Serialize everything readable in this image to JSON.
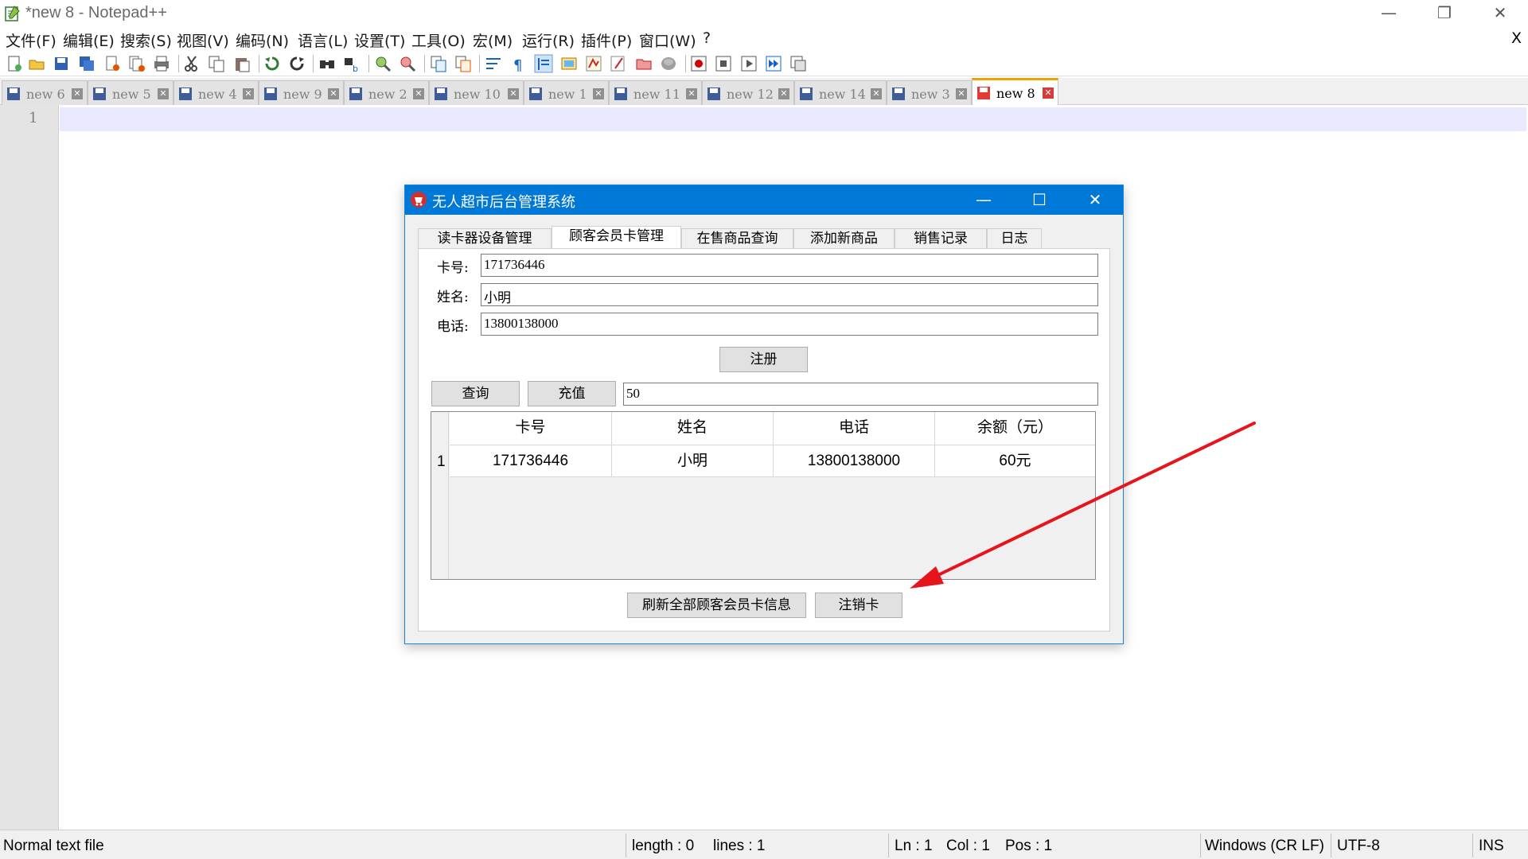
{
  "window": {
    "title": "*new 8 - Notepad++",
    "minimize": "—",
    "restore": "❐",
    "close": "✕"
  },
  "menu": {
    "items": [
      "文件(F)",
      "编辑(E)",
      "搜索(S)",
      "视图(V)",
      "编码(N)",
      "语言(L)",
      "设置(T)",
      "工具(O)",
      "宏(M)",
      "运行(R)",
      "插件(P)",
      "窗口(W)",
      "?"
    ],
    "close_doc": "X"
  },
  "toolbar": {
    "icons": [
      "new-file-icon",
      "open-file-icon",
      "save-icon",
      "save-all-icon",
      "close-icon",
      "close-all-icon",
      "print-icon",
      "cut-icon",
      "copy-icon",
      "paste-icon",
      "undo-icon",
      "redo-icon",
      "find-icon",
      "replace-icon",
      "zoom-in-icon",
      "zoom-out-icon",
      "sync-vertical-icon",
      "sync-horizontal-icon",
      "word-wrap-icon",
      "show-all-chars-icon",
      "indent-guide-icon",
      "doc-map-icon",
      "function-list-icon",
      "folder-as-workspace-icon",
      "monitoring-icon",
      "record-macro-icon",
      "stop-macro-icon",
      "play-macro-icon",
      "run-macro-multiple-icon",
      "save-macro-icon"
    ]
  },
  "tabs": [
    {
      "label": "new 6",
      "active": false
    },
    {
      "label": "new 5",
      "active": false
    },
    {
      "label": "new 4",
      "active": false
    },
    {
      "label": "new 9",
      "active": false
    },
    {
      "label": "new 2",
      "active": false
    },
    {
      "label": "new 10",
      "active": false
    },
    {
      "label": "new 1",
      "active": false
    },
    {
      "label": "new 11",
      "active": false
    },
    {
      "label": "new 12",
      "active": false
    },
    {
      "label": "new 14",
      "active": false
    },
    {
      "label": "new 3",
      "active": false
    },
    {
      "label": "new 8",
      "active": true
    }
  ],
  "editor": {
    "line_number": "1"
  },
  "statusbar": {
    "file_type": "Normal text file",
    "length": "length : 0",
    "lines": "lines : 1",
    "ln": "Ln : 1",
    "col": "Col : 1",
    "pos": "Pos : 1",
    "eol": "Windows (CR LF)",
    "encoding": "UTF-8",
    "mode": "INS"
  },
  "dialog": {
    "title": "无人超市后台管理系统",
    "tabs": [
      "读卡器设备管理",
      "顾客会员卡管理",
      "在售商品查询",
      "添加新商品",
      "销售记录",
      "日志"
    ],
    "active_tab": "顾客会员卡管理",
    "form": {
      "card_label": "卡号:",
      "card_value": "171736446",
      "name_label": "姓名:",
      "name_value": "小明",
      "phone_label": "电话:",
      "phone_value": "13800138000",
      "register_button": "注册",
      "query_button": "查询",
      "recharge_button": "充值",
      "recharge_value": "50"
    },
    "table": {
      "columns": [
        "卡号",
        "姓名",
        "电话",
        "余额（元）"
      ],
      "rows": [
        {
          "index": "1",
          "cells": [
            "171736446",
            "小明",
            "13800138000",
            "60元"
          ]
        }
      ]
    },
    "refresh_button": "刷新全部顾客会员卡信息",
    "cancel_card_button": "注销卡"
  },
  "colors": {
    "dialog_title_bar": "#0078d7",
    "annotation_arrow": "#e8141b",
    "active_tab_accent": "#f4a100",
    "current_line": "#e8e8ff"
  }
}
